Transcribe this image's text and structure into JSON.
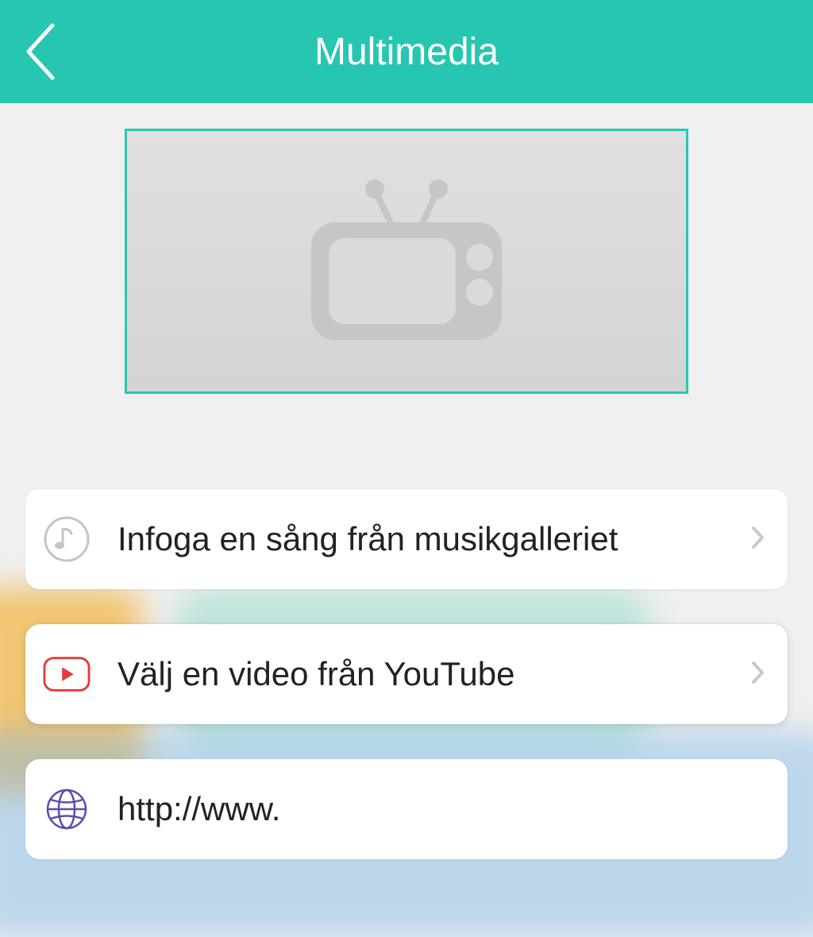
{
  "header": {
    "title": "Multimedia"
  },
  "options": {
    "music": {
      "label": "Infoga en sång från musikgalleriet"
    },
    "youtube": {
      "label": "Välj en video från YouTube"
    },
    "url": {
      "placeholder": "http://www."
    }
  }
}
